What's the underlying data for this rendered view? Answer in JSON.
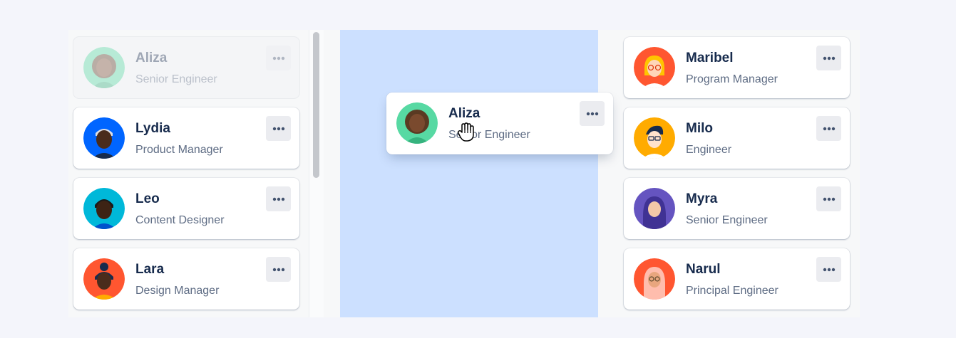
{
  "board": {
    "columns": [
      {
        "id": "left",
        "cards": [
          {
            "name": "Aliza",
            "role": "Senior Engineer",
            "state": "placeholder",
            "avatar": "person-avatar-green"
          },
          {
            "name": "Lydia",
            "role": "Product Manager",
            "avatar": "person-avatar-blue"
          },
          {
            "name": "Leo",
            "role": "Content Designer",
            "avatar": "person-avatar-teal"
          },
          {
            "name": "Lara",
            "role": "Design Manager",
            "avatar": "person-avatar-orange"
          }
        ]
      },
      {
        "id": "middle",
        "highlight_color": "#cce0ff",
        "cards": []
      },
      {
        "id": "right",
        "cards": [
          {
            "name": "Maribel",
            "role": "Program Manager",
            "avatar": "person-avatar-red"
          },
          {
            "name": "Milo",
            "role": "Engineer",
            "avatar": "person-avatar-yellow"
          },
          {
            "name": "Myra",
            "role": "Senior Engineer",
            "avatar": "person-avatar-purple"
          },
          {
            "name": "Narul",
            "role": "Principal Engineer",
            "avatar": "person-avatar-orange-red"
          }
        ]
      }
    ],
    "dragging_card": {
      "name": "Aliza",
      "role": "Senior Engineer",
      "avatar": "person-avatar-green"
    },
    "more_icon": "more-dots-icon",
    "cursor_icon": "grab-hand-cursor-icon"
  }
}
